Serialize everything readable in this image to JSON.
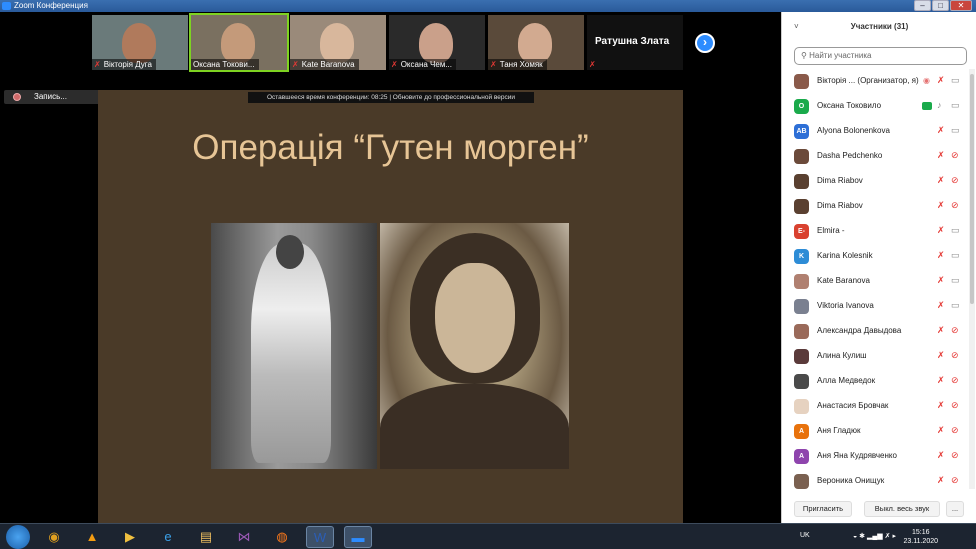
{
  "window": {
    "title": "Zoom Конференция",
    "controls": [
      "–",
      "□",
      "✕"
    ]
  },
  "thumbnails": [
    {
      "name": "Вікторія Дуга",
      "face_color": "#b07a5c"
    },
    {
      "name": "Оксана Токови...",
      "face_color": "#c49a7a"
    },
    {
      "name": "Kate Baranova",
      "face_color": "#d8b79c"
    },
    {
      "name": "Оксана Чем...",
      "face_color": "#caa08a"
    },
    {
      "name": "Таня Хомяк",
      "face_color": "#d2aa90"
    },
    {
      "name": "Ратушна Злата",
      "face_color": ""
    }
  ],
  "next_button": "›",
  "recording": {
    "label": "Запись..."
  },
  "banner": "Оставшееся время конференции: 08:25 | Обновите до профессиональной версии",
  "slide": {
    "title": "Операція “Гутен морген”"
  },
  "panel": {
    "title": "Участники (31)",
    "collapse_icon": "˅",
    "search_placeholder": "Найти участника",
    "participants": [
      {
        "name": "Вікторія ... (Организатор, я)",
        "avatar_text": "",
        "avatar_color": "#8a5a4a",
        "mic": "off",
        "video": "on",
        "recording": true
      },
      {
        "name": "Оксана Токовило",
        "avatar_text": "О",
        "avatar_color": "#1aaa4b",
        "mic": "on",
        "video": "on",
        "sharing": true
      },
      {
        "name": "Alyona Bolonenkova",
        "avatar_text": "AB",
        "avatar_color": "#2d6fd6",
        "mic": "off",
        "video": "on"
      },
      {
        "name": "Dasha Pedchenko",
        "avatar_text": "",
        "avatar_color": "#6b4a3a",
        "mic": "off",
        "video": "off"
      },
      {
        "name": "Dima Riabov",
        "avatar_text": "",
        "avatar_color": "#5a4030",
        "mic": "off",
        "video": "off"
      },
      {
        "name": "Dima Riabov",
        "avatar_text": "",
        "avatar_color": "#5a4030",
        "mic": "off",
        "video": "off"
      },
      {
        "name": "Elmira -",
        "avatar_text": "E-",
        "avatar_color": "#d9412f",
        "mic": "off",
        "video": "on"
      },
      {
        "name": "Karina Kolesnik",
        "avatar_text": "K",
        "avatar_color": "#2d8cd6",
        "mic": "off",
        "video": "on"
      },
      {
        "name": "Kate Baranova",
        "avatar_text": "",
        "avatar_color": "#b08070",
        "mic": "off",
        "video": "on"
      },
      {
        "name": "Viktoria Ivanova",
        "avatar_text": "",
        "avatar_color": "#7a8090",
        "mic": "off",
        "video": "on"
      },
      {
        "name": "Александра Давыдова",
        "avatar_text": "",
        "avatar_color": "#9a6a5a",
        "mic": "off",
        "video": "off"
      },
      {
        "name": "Алина Кулиш",
        "avatar_text": "",
        "avatar_color": "#5a3a3a",
        "mic": "off",
        "video": "off"
      },
      {
        "name": "Алла Медведок",
        "avatar_text": "",
        "avatar_color": "#4a4a4a",
        "mic": "off",
        "video": "off"
      },
      {
        "name": "Анастасия Бровчак",
        "avatar_text": "",
        "avatar_color": "#e6d2c0",
        "mic": "off",
        "video": "off"
      },
      {
        "name": "Аня Гладюк",
        "avatar_text": "А",
        "avatar_color": "#e8720c",
        "mic": "off",
        "video": "off"
      },
      {
        "name": "Аня Яна Кудрявченко",
        "avatar_text": "А",
        "avatar_color": "#8e44ad",
        "mic": "off",
        "video": "off"
      },
      {
        "name": "Вероника Онищук",
        "avatar_text": "",
        "avatar_color": "#7a6050",
        "mic": "off",
        "video": "off"
      }
    ],
    "invite_button": "Пригласить",
    "mute_all_button": "Выкл. весь звук",
    "more_button": "..."
  },
  "taskbar": {
    "apps": [
      {
        "icon": "chrome-icon",
        "glyph": "◉",
        "color": "#e0a020"
      },
      {
        "icon": "avast-icon",
        "glyph": "▲",
        "color": "#f39c12"
      },
      {
        "icon": "media-player-icon",
        "glyph": "▶",
        "color": "#f0c040"
      },
      {
        "icon": "ie-icon",
        "glyph": "e",
        "color": "#3aa0e8"
      },
      {
        "icon": "folder-icon",
        "glyph": "▤",
        "color": "#f0c060"
      },
      {
        "icon": "mail-icon",
        "glyph": "⋈",
        "color": "#9b59b6"
      },
      {
        "icon": "firefox-icon",
        "glyph": "◍",
        "color": "#ff7a1a"
      },
      {
        "icon": "word-icon",
        "glyph": "W",
        "color": "#2b5eb8"
      },
      {
        "icon": "zoom-icon",
        "glyph": "▬",
        "color": "#2d8cff"
      }
    ],
    "language": "UK",
    "time": "15:16",
    "date": "23.11.2020"
  }
}
